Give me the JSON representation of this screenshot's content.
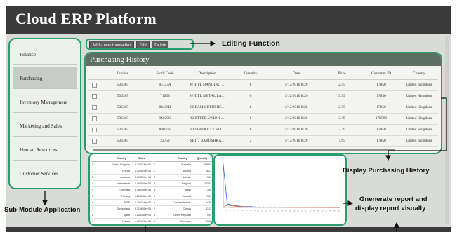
{
  "app": {
    "title": "Cloud ERP Platform"
  },
  "sidebar": {
    "items": [
      {
        "label": "Finance",
        "active": false
      },
      {
        "label": "Purchasing",
        "active": true
      },
      {
        "label": "Inventory Management",
        "active": false
      },
      {
        "label": "Marketing and Sales",
        "active": false
      },
      {
        "label": "Human Resources",
        "active": false
      },
      {
        "label": "Customer Services",
        "active": false
      }
    ]
  },
  "toolbar": {
    "add_label": "Add a new transaction",
    "edit_label": "Edit",
    "delete_label": "Delete"
  },
  "purchasing": {
    "title": "Purchasing History",
    "columns": [
      "Invoice",
      "Stock Code",
      "Description",
      "Quantity",
      "Date",
      "Price",
      "Customer ID",
      "Country"
    ],
    "rows": [
      [
        "536365",
        "85123A",
        "WHITE HANGING ...",
        "6",
        "1/12/2010 8:26",
        "2.55",
        "17850",
        "United Kingdom"
      ],
      [
        "536365",
        "71053",
        "WHITE METAL LA...",
        "6",
        "1/12/2010 8:26",
        "3.39",
        "17850",
        "United Kingdom"
      ],
      [
        "536365",
        "84406B",
        "CREAM CUPID HE...",
        "8",
        "1/12/2010 8:26",
        "2.75",
        "17850",
        "United Kingdom"
      ],
      [
        "536365",
        "84029G",
        "KNITTED UNION ...",
        "6",
        "1/12/2010 8:26",
        "3.39",
        "178509",
        "United Kingdom"
      ],
      [
        "536365",
        "84029E",
        "RED WOOLLY HO...",
        "6",
        "1/12/2010 8:26",
        "3.39",
        "17850",
        "United Kingdom"
      ],
      [
        "536365",
        "22752",
        "SET 7 BABUSHKA...",
        "2",
        "1/12/2010 8:26",
        "7.65",
        "17850",
        "United Kingdom"
      ]
    ]
  },
  "report_left": {
    "columns": [
      "Country",
      "Sales"
    ],
    "rows": [
      [
        "0",
        "United Kingdom",
        "2.245716e+06"
      ],
      [
        "1",
        "France",
        "4.304529e+04"
      ],
      [
        "2",
        "Australia",
        "4.304529e+04"
      ],
      [
        "3",
        "Netherlands",
        "5.482050e+03"
      ],
      [
        "4",
        "Germany",
        "3.785930e+04"
      ],
      [
        "5",
        "Norway",
        "5.528050e+03"
      ],
      [
        "6",
        "EIRE",
        "4.245719e+04"
      ],
      [
        "7",
        "Switzerland",
        "3.313600e+03"
      ],
      [
        "8",
        "Spain",
        "1.253340e+04"
      ],
      [
        "9",
        "Poland",
        "1.422070e+03"
      ]
    ]
  },
  "report_right": {
    "columns": [
      "Country",
      "Quantity"
    ],
    "rows": [
      [
        "0",
        "Australia",
        "83653"
      ],
      [
        "1",
        "Austria",
        "4827"
      ],
      [
        "2",
        "Bahrain",
        "260"
      ],
      [
        "3",
        "Belgium",
        "23152"
      ],
      [
        "4",
        "Brazil",
        "356"
      ],
      [
        "5",
        "Canada",
        "2763"
      ],
      [
        "6",
        "Channel Islands",
        "9479"
      ],
      [
        "7",
        "Cyprus",
        "6317"
      ],
      [
        "8",
        "Czech Republic",
        "592"
      ],
      [
        "9",
        "Denmark",
        "8188"
      ]
    ]
  },
  "chart_data": {
    "type": "line",
    "x": [
      "1",
      "2",
      "3",
      "4",
      "5",
      "6",
      "7",
      "8",
      "9",
      "10",
      "11",
      "12",
      "13",
      "14",
      "15",
      "16",
      "17",
      "18",
      "19",
      "20",
      "21",
      "22",
      "23",
      "24",
      "25",
      "26",
      "27",
      "28",
      "29",
      "30"
    ],
    "series": [
      {
        "values": [
          100,
          8,
          6,
          5,
          3,
          2,
          2,
          2,
          1,
          1,
          1,
          1,
          1,
          1,
          0.8,
          0.8,
          0.7,
          0.7,
          0.6,
          0.6,
          0.5,
          0.5,
          0.5,
          0.4,
          0.4,
          0.3,
          0.3,
          0.3,
          0.2,
          0.2
        ],
        "color": "#3f6fd0"
      },
      {
        "values": [
          0,
          6,
          4,
          3,
          2,
          2,
          1,
          1,
          1,
          1,
          1,
          0.8,
          0.7,
          0.6,
          0.6,
          0.5,
          0.5,
          0.4,
          0.4,
          0.4,
          0.3,
          0.3,
          0.3,
          0.2,
          0.2,
          0.2,
          0.2,
          0.1,
          0.1,
          0.1
        ],
        "color": "#e06030"
      }
    ],
    "ylim": [
      0,
      105
    ]
  },
  "annotations": {
    "editing": "Editing Function",
    "history": "Display Purchasing History",
    "report_line1": "Gnenerate report and",
    "report_line2": "display report visually",
    "submodule": "Sub-Module Application"
  },
  "colors": {
    "accent_frame": "#2a9d6e",
    "header_dark": "#3a3a3a",
    "panel_header": "#5d6f60"
  }
}
